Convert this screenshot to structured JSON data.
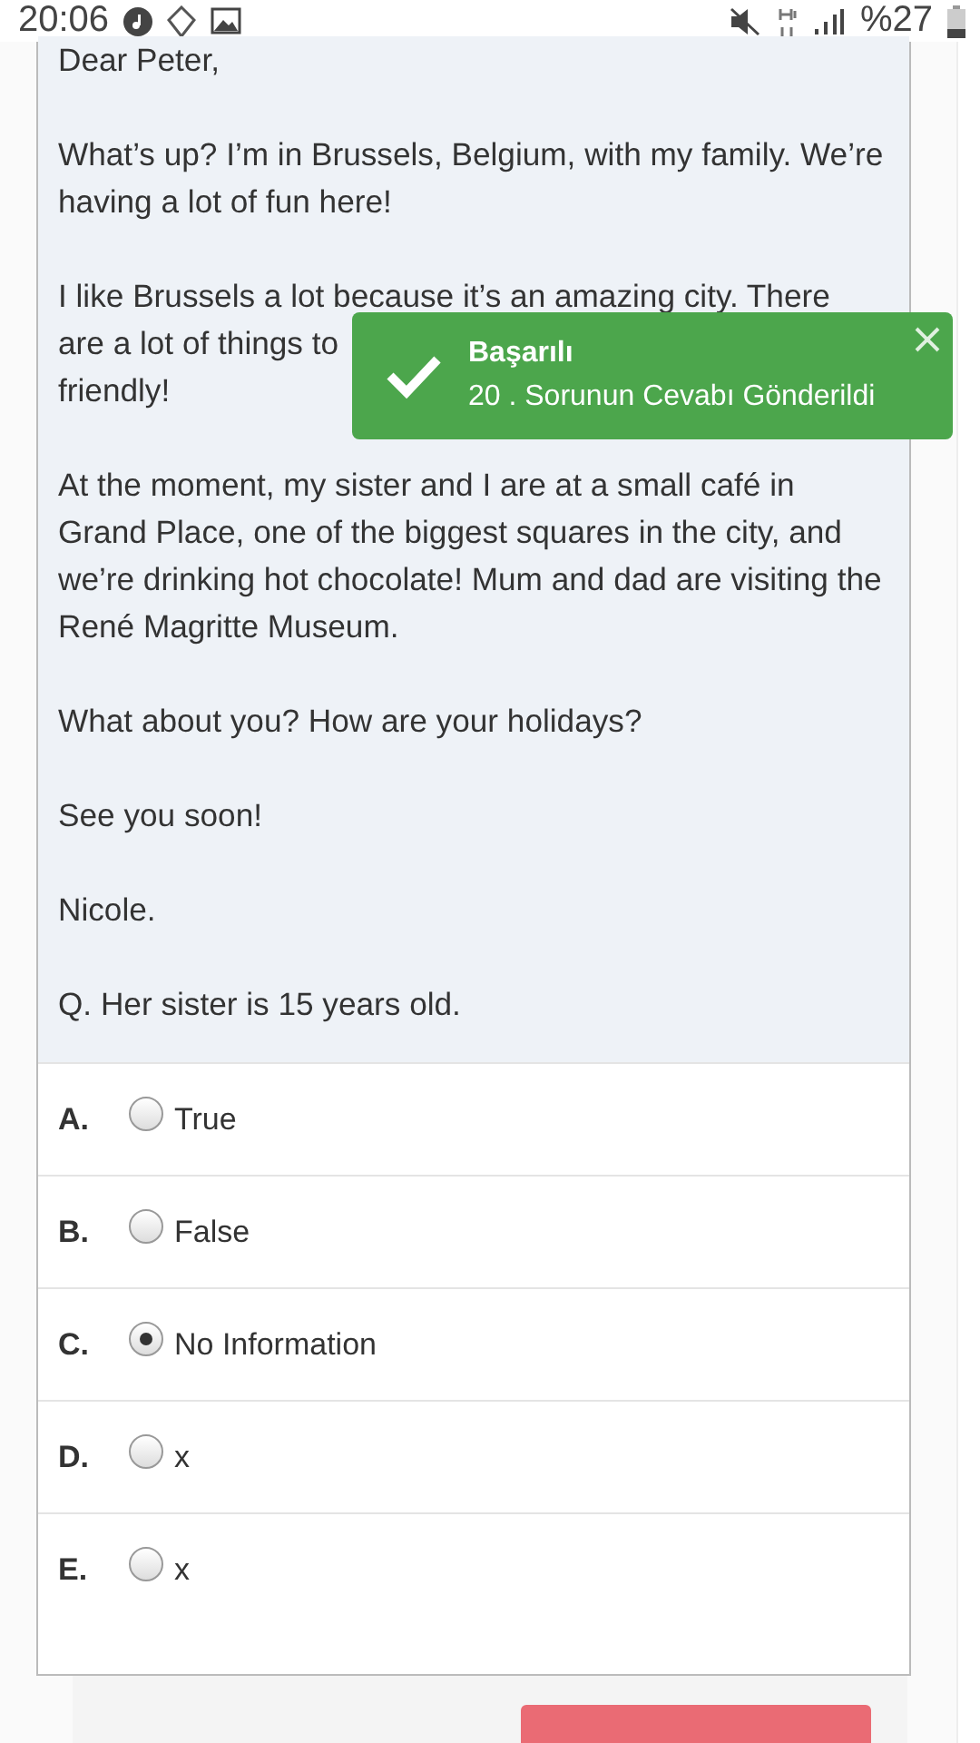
{
  "status_bar": {
    "time": "20:06",
    "battery": "%27"
  },
  "passage": {
    "paragraphs": [
      {
        "lines": [
          "Dear Peter,"
        ]
      },
      {
        "lines": [
          "What’s up?  I’m in Brussels, Belgium, with my family. We’re having a lot of fun here!"
        ]
      },
      {
        "lines": [
          "I like Brussels a lot because it’s an amazing city. There",
          "are a lot of things to",
          "friendly!"
        ]
      },
      {
        "lines": [
          "At the moment, my sister and I are at a small café in Grand Place, one of the biggest squares in the city, and we’re drinking hot chocolate! Mum and dad are visiting the René Magritte Museum."
        ]
      },
      {
        "lines": [
          "What about you? How are your holidays?"
        ]
      },
      {
        "lines": [
          "See you soon!"
        ]
      },
      {
        "lines": [
          "Nicole."
        ]
      },
      {
        "lines": [
          "Q. Her sister is 15 years old."
        ]
      }
    ]
  },
  "options": [
    {
      "letter": "A.",
      "label": "True",
      "selected": false
    },
    {
      "letter": "B.",
      "label": "False",
      "selected": false
    },
    {
      "letter": "C.",
      "label": "No Information",
      "selected": true
    },
    {
      "letter": "D.",
      "label": "x",
      "selected": false
    },
    {
      "letter": "E.",
      "label": "x",
      "selected": false
    }
  ],
  "toast": {
    "title": "Başarılı",
    "message": "20 . Sorunun Cevabı Gönderildi"
  }
}
